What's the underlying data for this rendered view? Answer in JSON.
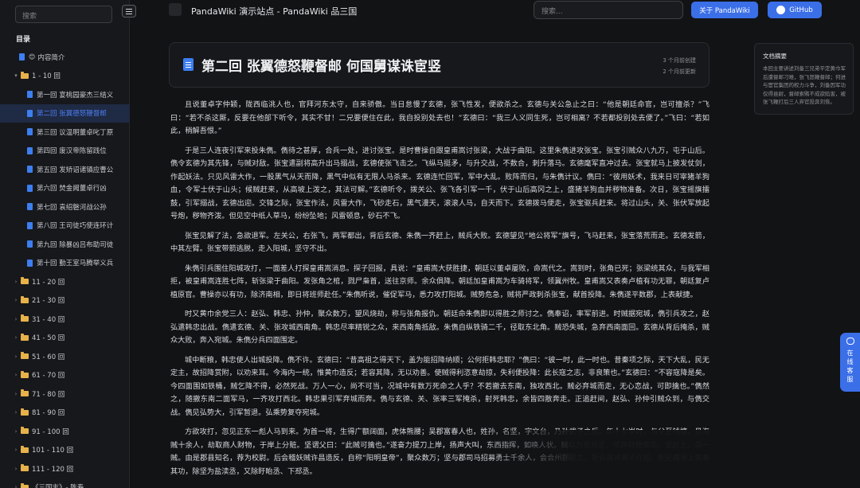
{
  "sidebar": {
    "search_placeholder": "搜索",
    "toc_title": "目录",
    "items": [
      {
        "type": "doc",
        "emoji": "😊",
        "label": "内容简介",
        "level": 1
      },
      {
        "type": "folder",
        "label": "1 - 10 回",
        "expanded": true,
        "level": 1
      },
      {
        "type": "doc",
        "label": "第一回 宴桃园豪杰三结义",
        "level": 2
      },
      {
        "type": "doc",
        "label": "第二回 张翼德怒鞭督邮",
        "level": 2,
        "active": true
      },
      {
        "type": "doc",
        "label": "第三回 议温明董卓叱丁原",
        "level": 2
      },
      {
        "type": "doc",
        "label": "第四回 废汉帝陈留践位",
        "level": 2
      },
      {
        "type": "doc",
        "label": "第五回 发矫诏诸镇应曹公",
        "level": 2
      },
      {
        "type": "doc",
        "label": "第六回 焚金阙董卓行凶",
        "level": 2
      },
      {
        "type": "doc",
        "label": "第七回 袁绍磐河战公孙",
        "level": 2
      },
      {
        "type": "doc",
        "label": "第八回 王司徒巧使连环计",
        "level": 2
      },
      {
        "type": "doc",
        "label": "第九回 除暴凶吕布助司徒",
        "level": 2
      },
      {
        "type": "doc",
        "label": "第十回 勤王室马腾举义兵",
        "level": 2
      },
      {
        "type": "folder",
        "label": "11 - 20 回",
        "level": 1
      },
      {
        "type": "folder",
        "label": "21 - 30 回",
        "level": 1
      },
      {
        "type": "folder",
        "label": "31 - 40 回",
        "level": 1
      },
      {
        "type": "folder",
        "label": "41 - 50 回",
        "level": 1
      },
      {
        "type": "folder",
        "label": "51 - 60 回",
        "level": 1
      },
      {
        "type": "folder",
        "label": "61 - 70 回",
        "level": 1
      },
      {
        "type": "folder",
        "label": "71 - 80 回",
        "level": 1
      },
      {
        "type": "folder",
        "label": "81 - 90 回",
        "level": 1
      },
      {
        "type": "folder",
        "label": "91 - 100 回",
        "level": 1
      },
      {
        "type": "folder",
        "label": "101 - 110 回",
        "level": 1
      },
      {
        "type": "folder",
        "label": "111 - 120 回",
        "level": 1
      },
      {
        "type": "folder",
        "label": "《三国志》- 陈寿",
        "level": 1
      }
    ]
  },
  "header": {
    "title": "PandaWiki 演示站点 - PandaWiki 品三国",
    "search_placeholder": "搜索...",
    "about_button": "关于 PandaWiki",
    "github_button": "GitHub"
  },
  "article": {
    "title": "第二回 张翼德怒鞭督邮 何国舅谋诛宦竖",
    "created": "3 个月前创建",
    "updated": "2 个月前更新",
    "paragraphs": [
      "且说董卓字仲颖，陇西临洮人也，官拜河东太守，自来骄傲。当日怠慢了玄德，张飞性发，便欲杀之。玄德与关公急止之曰：“他是朝廷命官，岂可擅杀？”飞曰：“若不杀这厮，反要在他部下听令，其实不甘！二兄要便住在此，我自投别处去也！”玄德曰：“我三人义同生死，岂可相离？不若都投别处去便了。”飞曰：“若如此，稍解吾恨。”",
      "于是三人连夜引军来投朱儁。儁待之甚厚，合兵一处，进讨张宝。是时曹操自跟皇甫嵩讨张梁，大战于曲阳。这里朱儁进攻张宝。张宝引贼众八九万，屯于山后。儁令玄德为其先锋，与贼对敌。张宝遣副将高升出马搦战，玄德使张飞击之。飞纵马挺矛，与升交战，不数合，刺升落马。玄德麾军直冲过去。张宝就马上披发仗剑，作起妖法。只见风雷大作，一股黑气从天而降，黑气中似有无限人马杀来。玄德连忙回军，军中大乱。败阵而归，与朱儁计议。儁曰：“彼用妖术，我来日可宰猪羊狗血，令军士伏于山头；候贼赶来，从高坡上泼之，其法可解。”玄德听令，拨关公、张飞各引军一千，伏于山后高冈之上，盛猪羊狗血并秽物准备。次日，张宝摇旗擂鼓，引军搦战，玄德出迎。交锋之际，张宝作法，风雷大作，飞砂走石，黑气漫天，滚滚人马，自天而下。玄德拨马便走，张宝驱兵赶来。将过山头，关、张伏军放起号炮，秽物齐泼。但见空中纸人草马，纷纷坠地；风雷顿息，砂石不飞。",
      "张宝见解了法，急欲退军。左关公，右张飞，两军都出，背后玄德、朱儁一齐赶上，贼兵大败。玄德望见“地公将军”旗号，飞马赶来，张宝落荒而走。玄德发箭，中其左臂。张宝带箭逃脱，走入阳城，坚守不出。",
      "朱儁引兵围住阳城攻打，一面差人打探皇甫嵩消息。探子回报，具说：“皇甫嵩大获胜捷，朝廷以董卓屡败，命嵩代之。嵩到时，张角已死；张梁统其众，与我军相拒，被皇甫嵩连胜七阵，斩张梁于曲阳。发张角之棺，戮尸枭首，送往京师。余众俱降。朝廷加皇甫嵩为车骑将军，领冀州牧。皇甫嵩又表奏卢植有功无罪，朝廷复卢植原官。曹操亦以有功，除济南相，即日将班师赴任。”朱儁听说，催促军马，悉力攻打阳城。贼势危急，贼将严政刺杀张宝，献首投降。朱儁遂平数郡，上表献捷。",
      "时又黄巾余党三人：赵弘、韩忠、孙仲，聚众数万，望风烧劫，称与张角报仇。朝廷命朱儁即以得胜之师讨之。儁奉诏，率军前进。时贼据宛城，儁引兵攻之，赵弘遣韩忠出战。儁遣玄德、关、张攻城西南角。韩忠尽率精锐之众，来西南角抵敌。朱儁自纵铁骑二千，径取东北角。贼恐失城，急弃西南面回。玄德从背后掩杀，贼众大败，奔入宛城。朱儁分兵四面围定。",
      "城中断粮，韩忠使人出城投降。儁不许。玄德曰：“昔高祖之得天下，盖为能招降纳顺；公何拒韩忠耶？”儁曰：“彼一时，此一时也。昔秦项之际，天下大乱，民无定主，故招降赏附，以劝来耳。今海内一统，惟黄巾造反；若容其降，无以劝善。使贼得利恣意劫掠，失利便投降：此长寇之志，非良策也。”玄德曰：“不容寇降是矣。今四面围如铁桶，贼乞降不得，必然死战。万人一心，尚不可当，况城中有数万死命之人乎？不若撤去东南，独攻西北。贼必弃城而走，无心恋战，可即擒也。”儁然之，随撤东南二面军马，一齐攻打西北。韩忠果引军弃城而奔。儁与玄德、关、张率三军掩杀，射死韩忠，余皆四散奔走。正追赶间，赵弘、孙仲引贼众到，与儁交战。儁见弘势大，引军暂退。弘乘势复夺宛城。",
      "方欲攻打，忽见正东一彪人马到来。为首一将，生得广额阔面，虎体熊腰；吴郡富春人也，姓孙，名坚，字文台，乃孙武子之后。年十七岁时，与父至钱塘，见海贼十余人，劫取商人财物，于岸上分赃。坚谓父曰：“此贼可擒也。”遂奋力提刀上岸，扬声大叫，东西指挥，如唤人状。贼以为官兵至，尽弃财物奔走。坚赶上，杀一贼。由是郡县知名，荐为校尉。后会稽妖贼许昌造反，自称“阳明皇帝”，聚众数万；坚与郡司马招募勇士千余人，会合州郡破之，斩许昌并其子许韶。刺史臧旻上表奏其功，除坚为盐渎丞，又除盱眙丞、下邳丞。"
    ]
  },
  "summary": {
    "title": "文档摘要",
    "text": "本回主要讲述刘备三兄弟平定黄巾军后遭督邮刁难，张飞怒鞭督邮；何进与宦官集团的权力斗争，刘备因军功仅得县尉，督邮索贿不成欲陷害，被张飞鞭打后三人弃官投奔刘恢。"
  },
  "service": {
    "label": "在线客服"
  }
}
